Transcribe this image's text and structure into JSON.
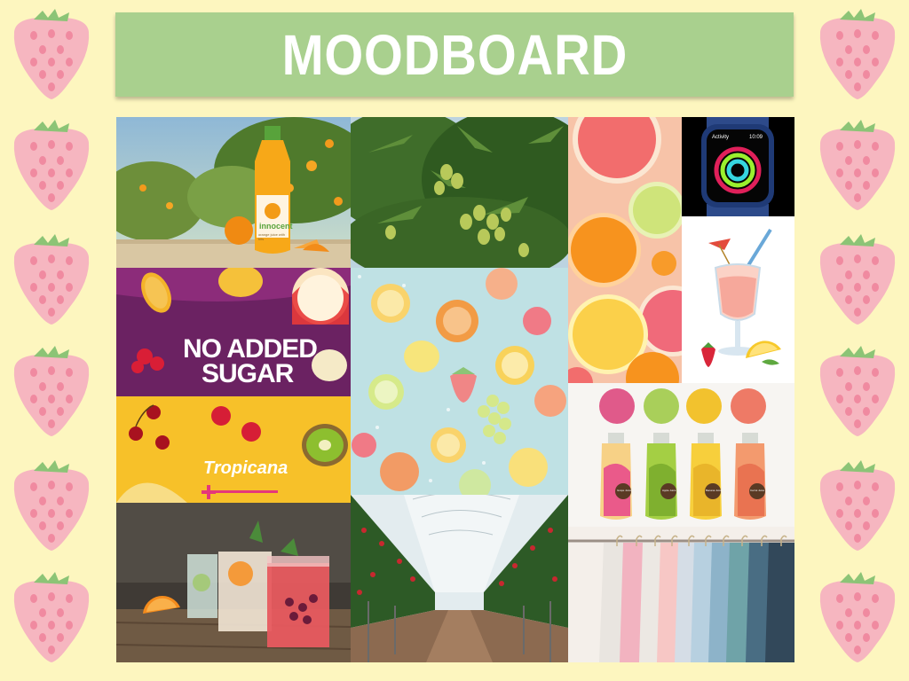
{
  "title": "MOODBOARD",
  "colors": {
    "background": "#fdf6bf",
    "title_bar": "#a9d08e",
    "strawberry": "#f6b6c0",
    "strawberry_leaf": "#8cc476"
  },
  "tiles": {
    "juice_bottle": {
      "brand": "innocent",
      "subtext": "orange juice with bits"
    },
    "no_added_sugar": {
      "line1": "NO ADDED",
      "line2": "SUGAR"
    },
    "tropicana": {
      "brand": "Tropicana"
    },
    "smartwatch": {
      "app": "Activity",
      "time": "10:09"
    },
    "juice_bottles": {
      "labels": [
        "Grape Juice",
        "Apple Juice",
        "Banana Juice",
        "Carrot Juice"
      ]
    }
  },
  "icons": [
    "strawberry-icon",
    "orange-icon",
    "lemon-icon",
    "apple-icon",
    "cocktail-icon",
    "watch-icon"
  ]
}
